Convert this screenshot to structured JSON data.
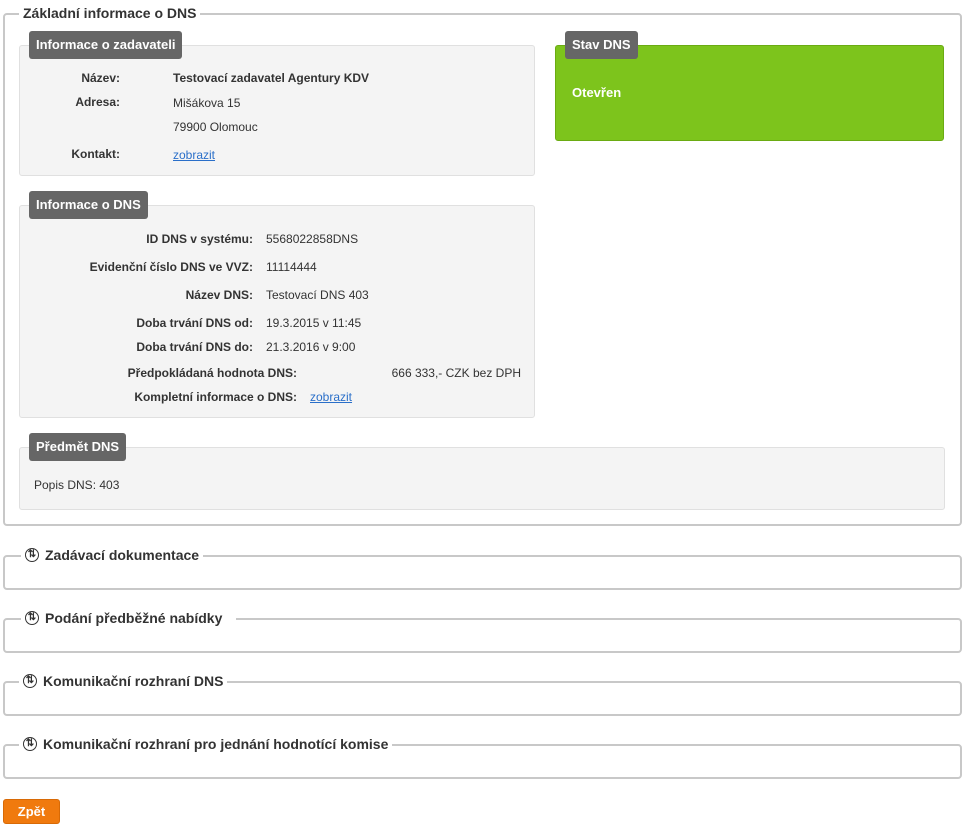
{
  "main": {
    "legend": "Základní informace o DNS",
    "zadavatel": {
      "tag": "Informace o zadavateli",
      "name_label": "Název:",
      "name_value": "Testovací zadavatel Agentury KDV",
      "address_label": "Adresa:",
      "address_line1": "Mišákova 15",
      "address_line2": "79900 Olomouc",
      "contact_label": "Kontakt:",
      "contact_link": "zobrazit"
    },
    "status": {
      "tag": "Stav DNS",
      "value": "Otevřen",
      "color": "#7dc41c"
    },
    "dns_info": {
      "tag": "Informace o DNS",
      "rows": [
        {
          "label": "ID DNS v systému:",
          "value": "5568022858DNS"
        },
        {
          "label": "Evidenční číslo DNS ve VVZ:",
          "value": "11114444"
        },
        {
          "label": "Název DNS:",
          "value": "Testovací DNS 403"
        },
        {
          "label": "Doba trvání DNS od:",
          "value": "19.3.2015 v 11:45"
        },
        {
          "label": "Doba trvání DNS do:",
          "value": "21.3.2016 v 9:00"
        }
      ],
      "expected_value_label": "Předpokládaná hodnota DNS:",
      "expected_value": "666 333,- CZK bez DPH",
      "full_info_label": "Kompletní informace o DNS:",
      "full_info_link": "zobrazit"
    },
    "subject": {
      "tag": "Předmět DNS",
      "text": "Popis DNS: 403"
    }
  },
  "sections": [
    {
      "label": "Zadávací dokumentace"
    },
    {
      "label": "Podání předběžné nabídky"
    },
    {
      "label": "Komunikační rozhraní DNS"
    },
    {
      "label": "Komunikační rozhraní pro jednání hodnotící komise"
    }
  ],
  "back_button": "Zpět",
  "colors": {
    "accent": "#f07a0e",
    "status": "#7dc41c",
    "tag": "#666666"
  }
}
